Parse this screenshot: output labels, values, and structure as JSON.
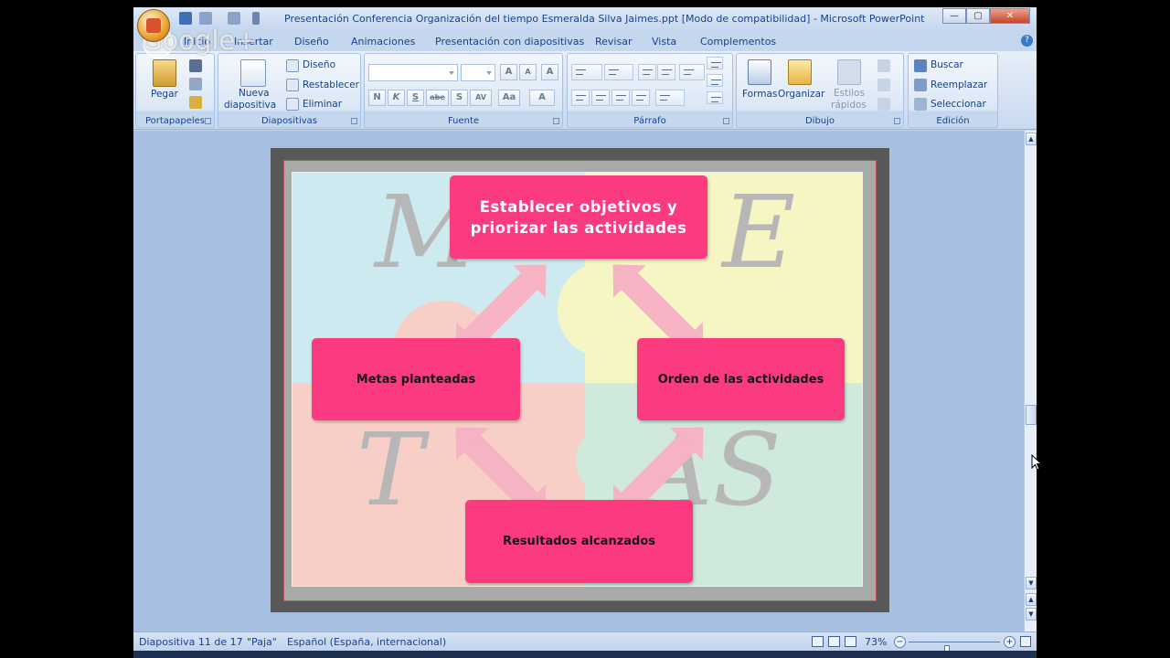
{
  "window": {
    "title": "Presentación Conferencia Organización del tiempo Esmeralda Silva Jaimes.ppt [Modo de compatibilidad] - Microsoft PowerPoint",
    "controls": {
      "minimize": "—",
      "maximize": "▢",
      "close": "✕"
    }
  },
  "overlay": {
    "watermark": "Google+"
  },
  "tabs": [
    "Inicio",
    "Insertar",
    "Diseño",
    "Animaciones",
    "Presentación con diapositivas",
    "Revisar",
    "Vista",
    "Complementos"
  ],
  "help_label": "?",
  "ribbon": {
    "portapapeles": {
      "label": "Portapapeles",
      "paste": "Pegar"
    },
    "diapositivas": {
      "label": "Diapositivas",
      "new_slide_1": "Nueva",
      "new_slide_2": "diapositiva",
      "layout": "Diseño",
      "reset": "Restablecer",
      "delete": "Eliminar"
    },
    "fuente": {
      "label": "Fuente",
      "font_name": "",
      "font_size": "",
      "grow": "A",
      "shrink": "A",
      "clear": "A",
      "bold": "N",
      "italic": "K",
      "underline": "S",
      "strike": "abe",
      "shadow": "S",
      "spacing": "AV",
      "case": "Aa",
      "color": "A"
    },
    "parrafo": {
      "label": "Párrafo"
    },
    "dibujo": {
      "label": "Dibujo",
      "shapes": "Formas",
      "arrange": "Organizar",
      "styles_1": "Estilos",
      "styles_2": "rápidos"
    },
    "edicion": {
      "label": "Edición",
      "find": "Buscar",
      "replace": "Reemplazar",
      "select": "Seleccionar"
    }
  },
  "slide": {
    "watermark_letters": [
      "M",
      "E",
      "T",
      "AS"
    ],
    "boxes": {
      "top_line1": "Establecer objetivos y",
      "top_line2": "priorizar las actividades",
      "left": "Metas planteadas",
      "right": "Orden de las actividades",
      "bottom": "Resultados alcanzados"
    }
  },
  "status": {
    "slide_counter": "Diapositiva 11 de 17",
    "theme": "\"Paja\"",
    "language": "Español (España, internacional)",
    "zoom": "73%",
    "zoom_level": 0.42
  }
}
